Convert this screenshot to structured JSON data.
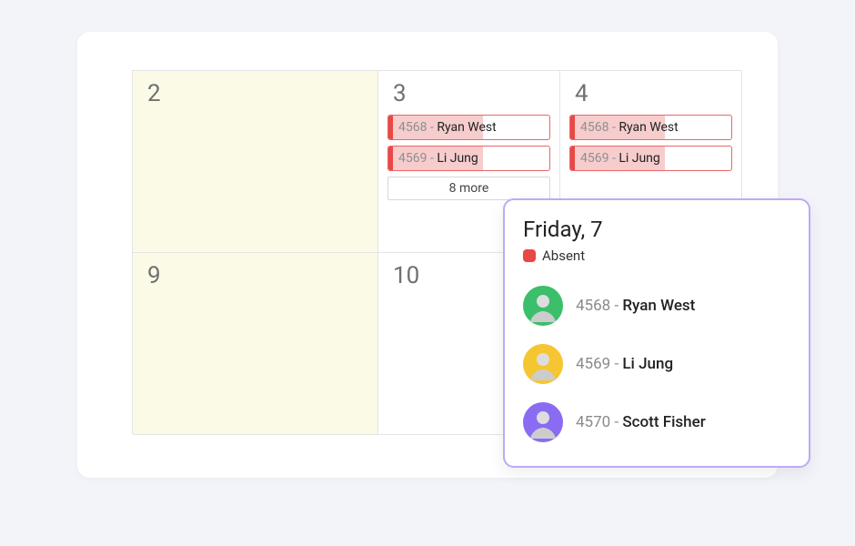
{
  "calendar": {
    "rows": [
      {
        "cells": [
          {
            "day": "2",
            "yellow": true
          },
          {
            "day": "3",
            "events": [
              {
                "id": "4568",
                "name": "Ryan West"
              },
              {
                "id": "4569",
                "name": "Li Jung"
              }
            ],
            "more": "8 more"
          },
          {
            "day": "4",
            "events": [
              {
                "id": "4568",
                "name": "Ryan West"
              },
              {
                "id": "4569",
                "name": "Li Jung"
              }
            ]
          }
        ]
      },
      {
        "cells": [
          {
            "day": "9",
            "yellow": true
          },
          {
            "day": "10"
          },
          {
            "day": ""
          }
        ]
      }
    ]
  },
  "popup": {
    "title": "Friday, 7",
    "legend": "Absent",
    "people": [
      {
        "id": "4568",
        "name": "Ryan West",
        "avatar_bg": "#3bbf6a"
      },
      {
        "id": "4569",
        "name": "Li Jung",
        "avatar_bg": "#f5c631"
      },
      {
        "id": "4570",
        "name": "Scott Fisher",
        "avatar_bg": "#8a6cf2"
      }
    ]
  },
  "colors": {
    "absent": "#e84846",
    "absent_fill": "#f6cccc",
    "popup_border": "#bfa9f5"
  }
}
